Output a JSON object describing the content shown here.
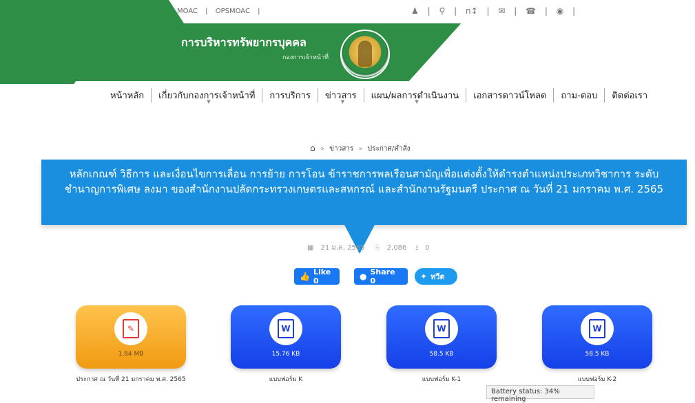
{
  "topbar": {
    "links": [
      "MOAC",
      "|",
      "OPSMOAC",
      "|"
    ],
    "icons": [
      "user-icon",
      "search-icon",
      "font-size-icon",
      "mail-icon",
      "phone-icon",
      "location-icon"
    ],
    "font_label": "n↕"
  },
  "brand": {
    "title": "การบริหารทรัพยากรบุคคล",
    "subtitle": "กองการเจ้าหน้าที่"
  },
  "nav": {
    "items": [
      {
        "label": "หน้าหลัก",
        "dropdown": false
      },
      {
        "label": "เกี่ยวกับกองการเจ้าหน้าที่",
        "dropdown": true
      },
      {
        "label": "การบริการ",
        "dropdown": false
      },
      {
        "label": "ข่าวสาร",
        "dropdown": true
      },
      {
        "label": "แผน/ผลการดำเนินงาน",
        "dropdown": true
      },
      {
        "label": "เอกสารดาวน์โหลด",
        "dropdown": false
      },
      {
        "label": "ถาม-ตอบ",
        "dropdown": false
      },
      {
        "label": "ติดต่อเรา",
        "dropdown": false
      }
    ]
  },
  "breadcrumb": {
    "items": [
      "ข่าวสาร",
      "ประกาศ/คำสั่ง"
    ]
  },
  "article": {
    "title": "หลักเกณฑ์ วิธีการ และเงื่อนไขการเลื่อน การย้าย การโอน ข้าราชการพลเรือนสามัญเพื่อแต่งตั้งให้ดำรงตำแหน่งประเภทวิชาการ ระดับชำนาญการพิเศษ ลงมา ของสำนักงานปลัดกระทรวงเกษตรและสหกรณ์ และสำนักงานรัฐมนตรี ประกาศ ณ วันที่ 21 มกราคม พ.ศ. 2565",
    "date": "21 ม.ค. 2565",
    "views": "2,086",
    "downloads": "0"
  },
  "share": {
    "like": "Like 0",
    "fb_share": "Share 0",
    "tweet": "ทวีต"
  },
  "files": [
    {
      "type": "pdf",
      "size": "1.84 MB",
      "caption": "ประกาศ ณ วันที่ 21 มกราคม พ.ศ. 2565"
    },
    {
      "type": "word",
      "size": "15.76 KB",
      "caption": "แบบฟอร์ม K"
    },
    {
      "type": "word",
      "size": "58.5 KB",
      "caption": "แบบฟอร์ม K-1"
    },
    {
      "type": "word",
      "size": "58.5 KB",
      "caption": "แบบฟอร์ม K-2"
    }
  ],
  "status_tooltip": "Battery status: 34% remaining",
  "colors": {
    "brand_green": "#2f8e45",
    "accent_blue": "#1a8fe0",
    "card_blue": "#1f4ff0",
    "card_orange": "#f5ac2a"
  }
}
